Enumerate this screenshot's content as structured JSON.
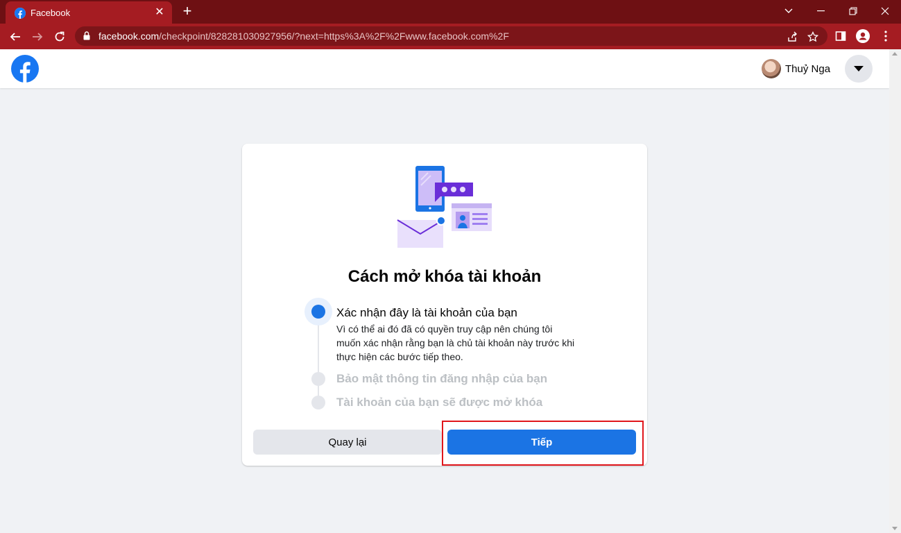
{
  "browser": {
    "tab_title": "Facebook",
    "tab_close": "✕",
    "new_tab": "+",
    "url_host": "facebook.com",
    "url_path": "/checkpoint/828281030927956/?next=https%3A%2F%2Fwww.facebook.com%2F"
  },
  "header": {
    "profile_name": "Thuỷ Nga"
  },
  "card": {
    "title": "Cách mở khóa tài khoản",
    "steps": [
      {
        "title": "Xác nhận đây là tài khoản của bạn",
        "description": "Vì có thể ai đó đã có quyền truy cập nên chúng tôi muốn xác nhận rằng bạn là chủ tài khoản này trước khi thực hiện các bước tiếp theo."
      },
      {
        "title": "Bảo mật thông tin đăng nhập của bạn"
      },
      {
        "title": "Tài khoản của bạn sẽ được mở khóa"
      }
    ],
    "back_label": "Quay lại",
    "next_label": "Tiếp"
  },
  "colors": {
    "brand": "#1b74e4",
    "highlight": "#e0161b",
    "chrome_frame": "#6e1013",
    "chrome_toolbar": "#a51c22"
  }
}
